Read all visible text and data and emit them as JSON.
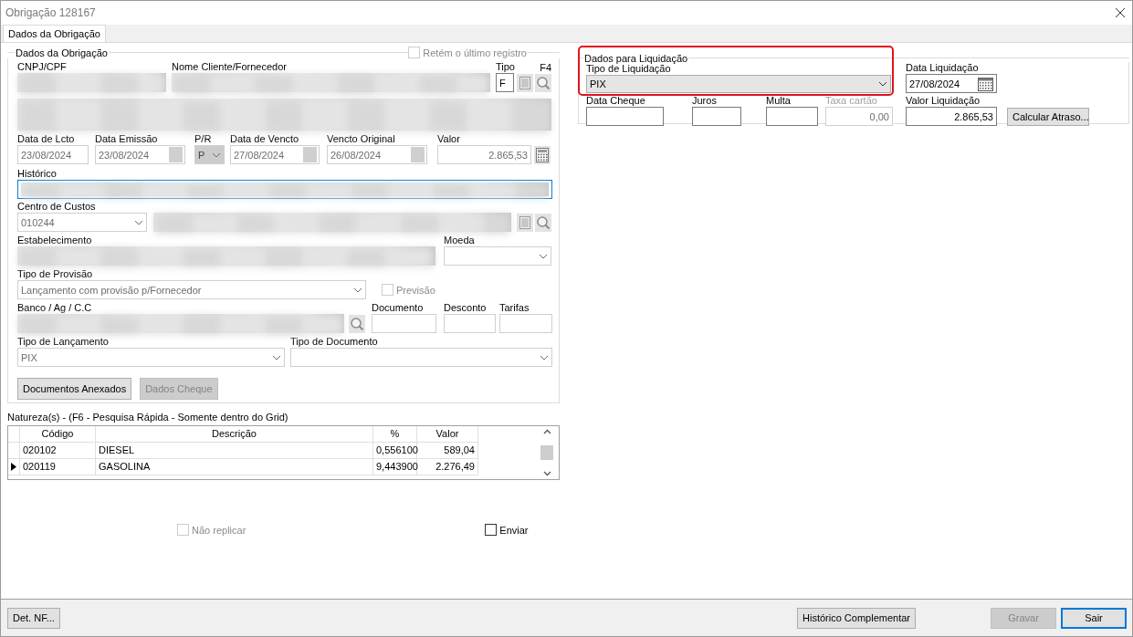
{
  "window": {
    "title": "Obrigação 128167"
  },
  "tabs": [
    {
      "label": "Dados da Obrigação",
      "selected": true
    }
  ],
  "obligation": {
    "legend": "Dados da Obrigação",
    "retain_last": {
      "label": "Retém o último registro",
      "checked": false,
      "disabled": true
    },
    "cnpj": {
      "label": "CNPJ/CPF"
    },
    "client_name": {
      "label": "Nome Cliente/Fornecedor"
    },
    "tipo": {
      "label": "Tipo",
      "value": "F"
    },
    "f4": "F4",
    "data_lcto": {
      "label": "Data de Lcto",
      "value": "23/08/2024"
    },
    "data_emissao": {
      "label": "Data Emissão",
      "value": "23/08/2024"
    },
    "pr": {
      "label": "P/R",
      "value": "P"
    },
    "data_vencto": {
      "label": "Data de Vencto",
      "value": "27/08/2024"
    },
    "vencto_original": {
      "label": "Vencto Original",
      "value": "26/08/2024"
    },
    "valor": {
      "label": "Valor",
      "value": "2.865,53"
    },
    "historico": {
      "label": "Histórico",
      "focused": true
    },
    "centro_custos": {
      "label": "Centro de Custos",
      "value": "010244"
    },
    "estabelecimento": {
      "label": "Estabelecimento"
    },
    "moeda": {
      "label": "Moeda"
    },
    "tipo_provisao": {
      "label": "Tipo de Provisão",
      "value": "Lançamento com provisão p/Fornecedor"
    },
    "previsao": {
      "label": "Previsão",
      "checked": false,
      "disabled": true
    },
    "banco": {
      "label": "Banco / Ag / C.C"
    },
    "documento": {
      "label": "Documento"
    },
    "desconto": {
      "label": "Desconto"
    },
    "tarifas": {
      "label": "Tarifas"
    },
    "tipo_lancamento": {
      "label": "Tipo de Lançamento",
      "value": "PIX"
    },
    "tipo_documento": {
      "label": "Tipo de Documento"
    },
    "buttons": [
      {
        "label": "Documentos Anexados",
        "disabled": false
      },
      {
        "label": "Dados Cheque",
        "disabled": true
      }
    ]
  },
  "natures": {
    "caption": "Natureza(s) - (F6 - Pesquisa Rápida - Somente dentro do Grid)",
    "columns": [
      "Código",
      "Descrição",
      "%",
      "Valor"
    ],
    "rows": [
      {
        "cells": [
          "020102",
          "DIESEL",
          "0,556100",
          "589,04"
        ],
        "selected": false
      },
      {
        "cells": [
          "020119",
          "GASOLINA",
          "9,443900",
          "2.276,49"
        ],
        "selected": true
      }
    ]
  },
  "options": [
    {
      "label": "Não replicar",
      "checked": false,
      "disabled": true
    },
    {
      "label": "Enviar",
      "checked": false,
      "disabled": false
    }
  ],
  "liquidation": {
    "legend": "Dados para Liquidação",
    "tipo": {
      "label": "Tipo de Liquidação",
      "value": "PIX"
    },
    "data": {
      "label": "Data Liquidação",
      "value": "27/08/2024"
    },
    "data_cheque": {
      "label": "Data Cheque"
    },
    "juros": {
      "label": "Juros"
    },
    "multa": {
      "label": "Multa"
    },
    "taxa": {
      "label": "Taxa cartão",
      "value": "0,00",
      "disabled": true
    },
    "valor": {
      "label": "Valor Liquidação",
      "value": "2.865,53"
    },
    "calc_button": "Calcular Atraso..."
  },
  "footer": {
    "left": [
      {
        "label": "Det. NF...",
        "disabled": false,
        "focused": false
      }
    ],
    "middle": [
      {
        "label": "Histórico Complementar",
        "disabled": false,
        "focused": false
      }
    ],
    "right": [
      {
        "label": "Gravar",
        "disabled": true,
        "focused": false
      },
      {
        "label": "Sair",
        "disabled": false,
        "focused": true
      }
    ]
  }
}
